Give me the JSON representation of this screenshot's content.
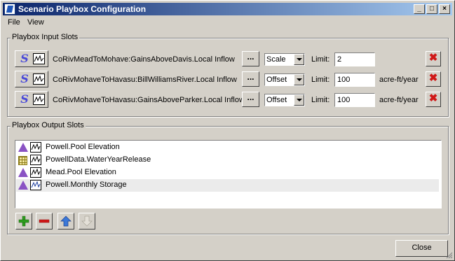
{
  "window": {
    "title": "Scenario Playbox Configuration"
  },
  "menu": {
    "items": [
      "File",
      "View"
    ]
  },
  "input_group": {
    "title": "Playbox Input Slots",
    "limit_label": "Limit:",
    "slots": [
      {
        "name": "CoRivMeadToMohave:GainsAboveDavis.Local Inflow",
        "mode": "Scale",
        "limit": "2",
        "units": ""
      },
      {
        "name": "CoRivMohaveToHavasu:BillWilliamsRiver.Local Inflow",
        "mode": "Offset",
        "limit": "100",
        "units": "acre-ft/year"
      },
      {
        "name": "CoRivMohaveToHavasu:GainsAboveParker.Local Inflow",
        "mode": "Offset",
        "limit": "100",
        "units": "acre-ft/year"
      }
    ],
    "dots_label": "..."
  },
  "output_group": {
    "title": "Playbox Output Slots",
    "slots": [
      {
        "name": "Powell.Pool Elevation",
        "icon": "reservoir-icon"
      },
      {
        "name": "PowellData.WaterYearRelease",
        "icon": "data-table-icon"
      },
      {
        "name": "Mead.Pool Elevation",
        "icon": "reservoir-icon"
      },
      {
        "name": "Powell.Monthly Storage",
        "icon": "reservoir-icon",
        "selected": true
      }
    ]
  },
  "buttons": {
    "close": "Close"
  },
  "colors": {
    "title_start": "#0a246a",
    "title_end": "#a6caf0",
    "delete": "#d01818",
    "add": "#2e9e1e",
    "move_up": "#3b78d8"
  }
}
